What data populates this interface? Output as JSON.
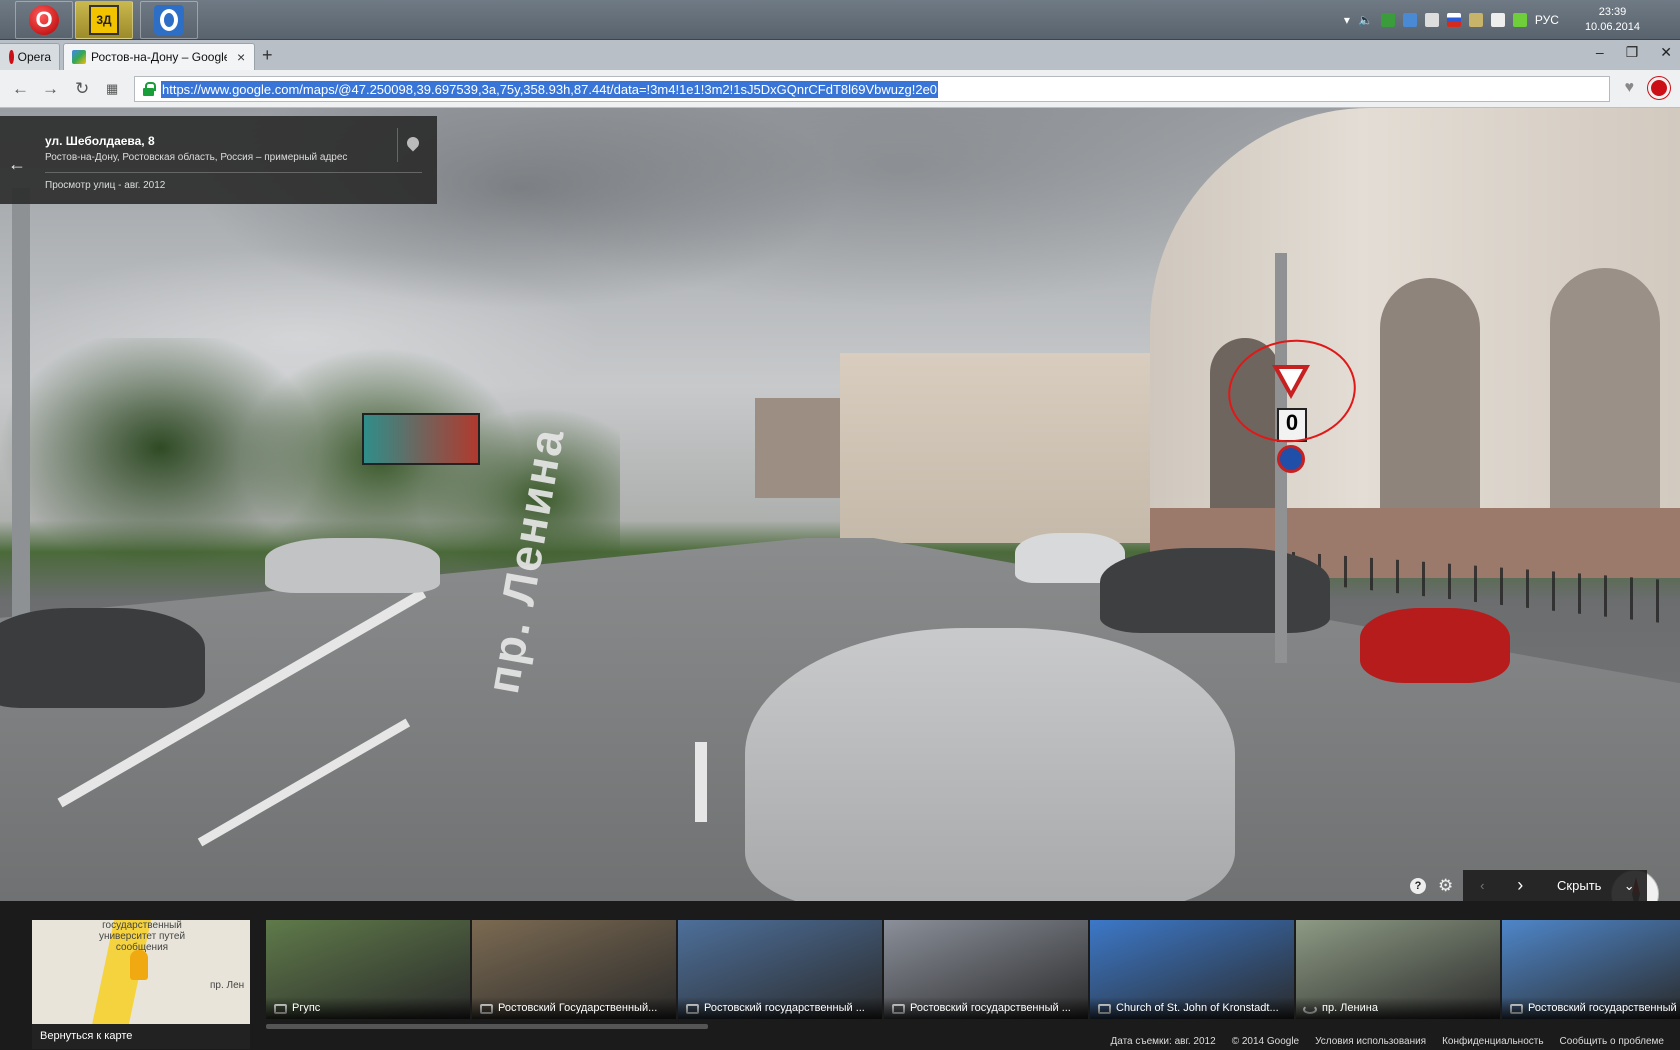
{
  "taskbar": {
    "apps": [
      {
        "name": "opera-app"
      },
      {
        "name": "video-app",
        "label": "3Д"
      },
      {
        "name": "opera-next-app"
      }
    ],
    "tray": {
      "language": "РУС",
      "time": "23:39",
      "date": "10.06.2014"
    }
  },
  "browser": {
    "menu_label": "Opera",
    "tab_title": "Ростов-на-Дону – Google",
    "url": "https://www.google.com/maps/@47.250098,39.697539,3a,75y,358.93h,87.44t/data=!3m4!1e1!3m2!1sJ5DxGQnrCFdT8l69Vbwuzg!2e0"
  },
  "streetview": {
    "address_title": "ул. Шеболдаева, 8",
    "address_sub": "Ростов-на-Дону, Ростовская область, Россия – примерный адрес",
    "capture_date": "Просмотр улиц - авг. 2012",
    "road_marking": "пр. Ленина",
    "sign_plate": "0",
    "hide_label": "Скрыть",
    "zoom_in": "+",
    "zoom_out": "−"
  },
  "filmstrip": {
    "map": {
      "label_top": "государственный университет путей сообщения",
      "label_street": "пр. Лен",
      "back_label": "Вернуться к карте"
    },
    "thumbs": [
      {
        "caption": "Ргупс",
        "icon": "camera-icon",
        "color": "#5f7a4a"
      },
      {
        "caption": "Ростовский Государственный...",
        "icon": "camera-icon",
        "color": "#7b6a52"
      },
      {
        "caption": "Ростовский государственный ...",
        "icon": "camera-icon",
        "color": "#4d6f9a"
      },
      {
        "caption": "Ростовский государственный ...",
        "icon": "camera-icon",
        "color": "#8a8f99"
      },
      {
        "caption": "Church of St. John of Kronstadt...",
        "icon": "camera-icon",
        "color": "#3c78c8"
      },
      {
        "caption": "пр. Ленина",
        "icon": "panorama-icon",
        "color": "#8d9a84"
      },
      {
        "caption": "Ростовский государственный",
        "icon": "camera-icon",
        "color": "#4e86c9"
      }
    ]
  },
  "footer": {
    "capture": "Дата съемки: авг. 2012",
    "copyright": "© 2014 Google",
    "terms": "Условия использования",
    "privacy": "Конфиденциальность",
    "report": "Сообщить о проблеме"
  }
}
